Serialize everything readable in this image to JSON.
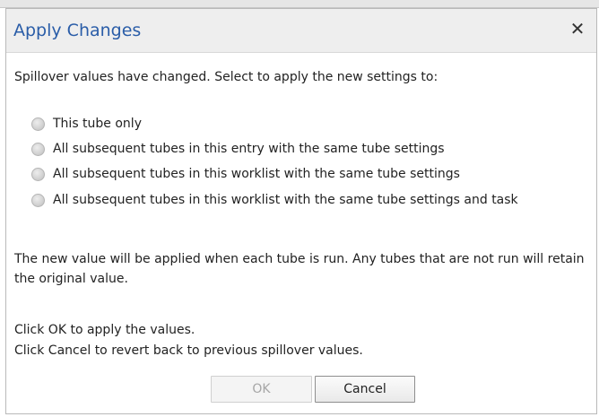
{
  "dialog": {
    "title": "Apply Changes",
    "close_glyph": "✕",
    "prompt": "Spillover values have changed. Select to apply the new settings to:",
    "options": [
      {
        "label": "This tube only",
        "selected": false
      },
      {
        "label": "All subsequent tubes in this entry with the same tube settings",
        "selected": false
      },
      {
        "label": "All subsequent tubes in this worklist with the same tube settings",
        "selected": false
      },
      {
        "label": "All subsequent tubes in this worklist with the same tube settings and task",
        "selected": false
      }
    ],
    "info_apply": "The new value will be applied when each tube is run. Any tubes that are not run will retain the original value.",
    "info_ok": "Click OK to apply the values.",
    "info_cancel": "Click Cancel to revert back to previous spillover values.",
    "ok_label": "OK",
    "ok_enabled": false,
    "cancel_label": "Cancel"
  },
  "icons": {
    "close": "close-icon",
    "radio": "radio-button-icon"
  },
  "colors": {
    "title_text": "#2a5da8",
    "titlebar_bg": "#eeeeee",
    "disabled_text": "#a6a6a6"
  }
}
